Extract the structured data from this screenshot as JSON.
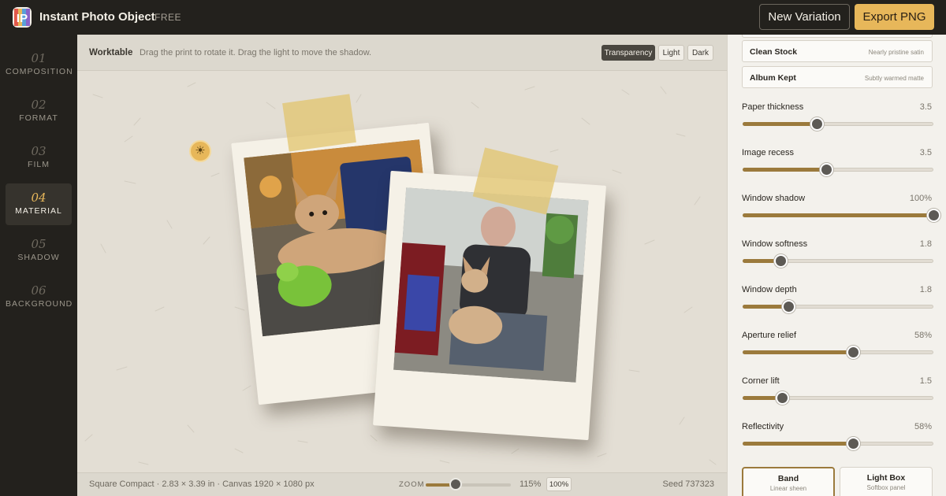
{
  "app": {
    "title": "Instant Photo Object",
    "tier": "FREE"
  },
  "toolbar": {
    "new_variation": "New Variation",
    "export": "Export PNG"
  },
  "nav": [
    {
      "num": "01",
      "label": "COMPOSITION"
    },
    {
      "num": "02",
      "label": "FORMAT"
    },
    {
      "num": "03",
      "label": "FILM"
    },
    {
      "num": "04",
      "label": "MATERIAL",
      "active": true
    },
    {
      "num": "05",
      "label": "SHADOW"
    },
    {
      "num": "06",
      "label": "BACKGROUND"
    }
  ],
  "worktable": {
    "title": "Worktable",
    "hint": "Drag the print to rotate it. Drag the light to move the shadow.",
    "views": [
      "Transparency",
      "Light",
      "Dark"
    ],
    "active_view": "Transparency"
  },
  "status": {
    "spec": "Square Compact · 2.83 × 3.39 in · Canvas 1920 × 1080 px",
    "zoom_label": "ZOOM",
    "zoom_value": "115%",
    "zoom_level": 0.35,
    "zoom_reset": "100%",
    "seed": "Seed 737323"
  },
  "presets": [
    {
      "name": "Clean Stock",
      "desc": "Nearly pristine satin"
    },
    {
      "name": "Album Kept",
      "desc": "Subtly warmed matte"
    }
  ],
  "controls": [
    {
      "label": "Paper thickness",
      "value": "3.5",
      "level": 0.39
    },
    {
      "label": "Image recess",
      "value": "3.5",
      "level": 0.44
    },
    {
      "label": "Window shadow",
      "value": "100%",
      "level": 1.0
    },
    {
      "label": "Window softness",
      "value": "1.8",
      "level": 0.2
    },
    {
      "label": "Window depth",
      "value": "1.8",
      "level": 0.24
    },
    {
      "label": "Aperture relief",
      "value": "58%",
      "level": 0.58
    },
    {
      "label": "Corner lift",
      "value": "1.5",
      "level": 0.21
    },
    {
      "label": "Reflectivity",
      "value": "58%",
      "level": 0.58
    }
  ],
  "modes": [
    {
      "name": "Band",
      "desc": "Linear sheen",
      "active": true
    },
    {
      "name": "Light Box",
      "desc": "Softbox panel"
    }
  ],
  "icons": {
    "logo": "app-logo-icon",
    "light": "sun-icon"
  },
  "colors": {
    "accent": "#e7b75a",
    "slider_fill": "#9b7a3c",
    "dark": "#23211d"
  }
}
